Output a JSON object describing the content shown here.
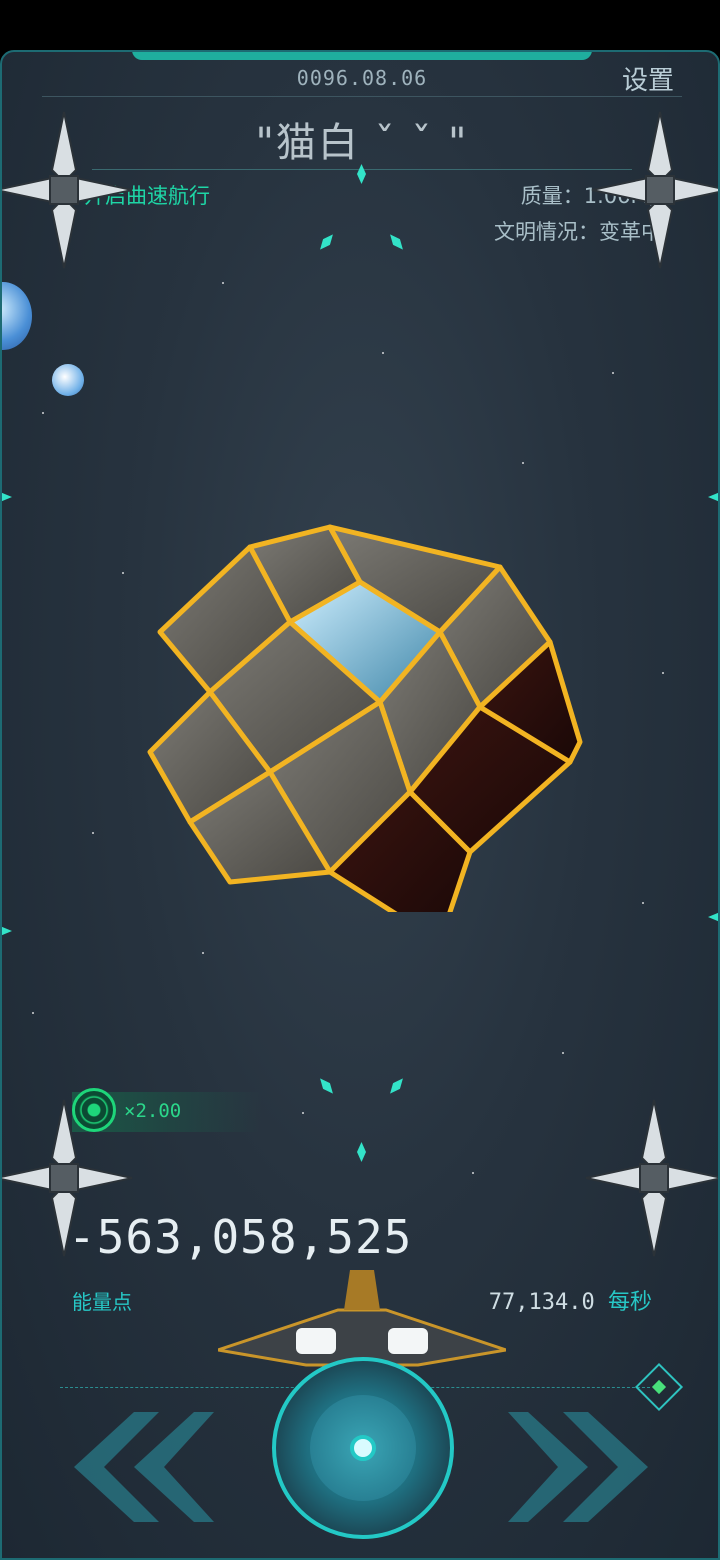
{
  "header": {
    "date": "0096.08.06",
    "settings_label": "设置",
    "civilization_name": "\"猫白 ˇ ˇ \"",
    "warp_button_label": "开启曲速航行",
    "quality_label": "质量：1.06Mp",
    "civilization_status": "文明情况：变革中"
  },
  "boost": {
    "multiplier_text": "×2.00"
  },
  "resources": {
    "energy_value": "-563,058,525",
    "energy_label": "能量点",
    "rate_value": "77,134.0",
    "rate_unit": "每秒"
  },
  "colors": {
    "accent": "#23c9c6",
    "green": "#1ed6a6",
    "gold": "#f2b422",
    "background": "#27333f"
  },
  "icons": {
    "left": "chevron-double-left-icon",
    "right": "chevron-double-right-icon",
    "center": "target-button-icon",
    "boost": "boost-orb-icon",
    "corner": "drone-ship-icon"
  }
}
